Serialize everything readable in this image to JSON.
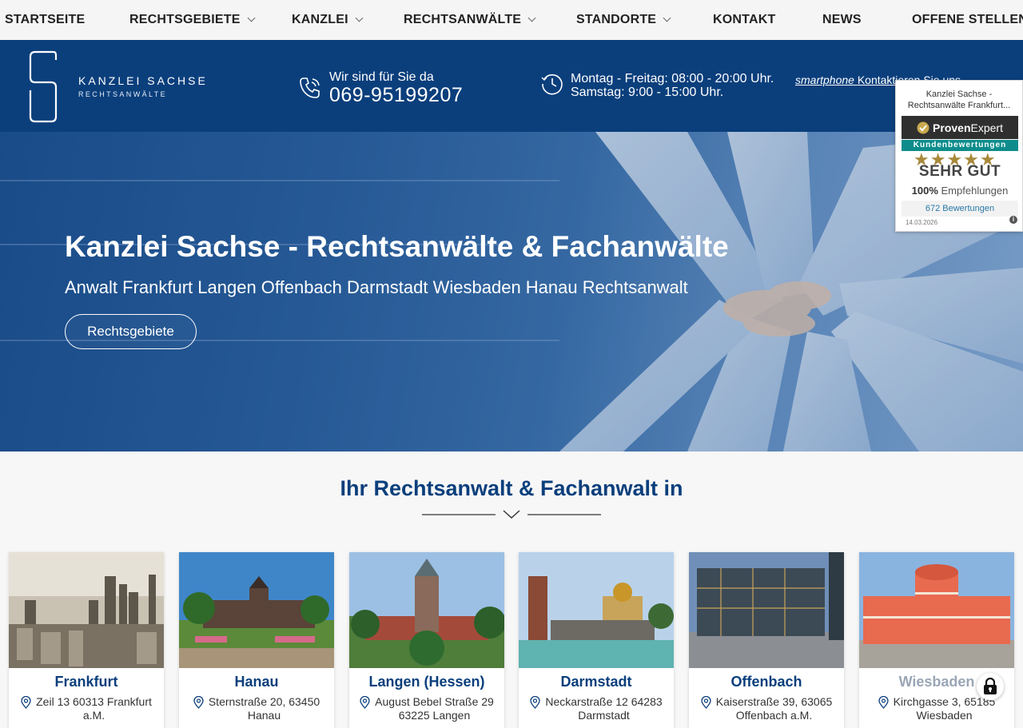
{
  "nav": {
    "items": [
      {
        "label": "STARTSEITE",
        "has_dropdown": false
      },
      {
        "label": "RECHTSGEBIETE",
        "has_dropdown": true
      },
      {
        "label": "KANZLEI",
        "has_dropdown": true
      },
      {
        "label": "RECHTSANWÄLTE",
        "has_dropdown": true
      },
      {
        "label": "STANDORTE",
        "has_dropdown": true
      },
      {
        "label": "KONTAKT",
        "has_dropdown": false
      },
      {
        "label": "NEWS",
        "has_dropdown": false
      },
      {
        "label": "OFFENE STELLEN",
        "has_dropdown": false
      }
    ]
  },
  "header": {
    "logo_name": "KANZLEI SACHSE",
    "logo_sub": "RECHTSANWÄLTE",
    "phone_label": "Wir sind für Sie da",
    "phone_number": "069-95199207",
    "hours_weekdays": "Montag - Freitag: 08:00 - 20:00 Uhr.",
    "hours_saturday": "Samstag: 9:00 - 15:00 Uhr.",
    "contact_icon_text": "smartphone",
    "contact_text": "Kontaktieren Sie uns"
  },
  "hero": {
    "title": "Kanzlei Sachse - Rechtsanwälte & Fachanwälte",
    "subtitle": "Anwalt Frankfurt Langen Offenbach Darmstadt Wiesbaden Hanau Rechtsanwalt",
    "button": "Rechtsgebiete"
  },
  "provenexpert": {
    "title_line1": "Kanzlei Sachse -",
    "title_line2": "Rechtsanwälte Frankfurt...",
    "brand_bold": "Proven",
    "brand_rest": "Expert",
    "ribbon": "Kundenbewertungen",
    "stars": "★★★★★",
    "rating": "SEHR GUT",
    "recommend_pct": "100%",
    "recommend_text": "Empfehlungen",
    "reviews": "672 Bewertungen",
    "date": "14.03.2026"
  },
  "section": {
    "title": "Ihr Rechtsanwalt & Fachanwalt in"
  },
  "locations": [
    {
      "city": "Frankfurt",
      "addr1": "Zeil 13 60313 Frankfurt",
      "addr2": "a.M."
    },
    {
      "city": "Hanau",
      "addr1": "Sternstraße 20, 63450",
      "addr2": "Hanau"
    },
    {
      "city": "Langen (Hessen)",
      "addr1": "August Bebel Straße 29",
      "addr2": "63225 Langen"
    },
    {
      "city": "Darmstadt",
      "addr1": "Neckarstraße 12 64283",
      "addr2": "Darmstadt"
    },
    {
      "city": "Offenbach",
      "addr1": "Kaiserstraße 39, 63065",
      "addr2": "Offenbach a.M."
    },
    {
      "city": "Wiesbaden",
      "addr1": "Kirchgasse 3, 65185",
      "addr2": "Wiesbaden"
    }
  ],
  "colors": {
    "brand_blue": "#0b3f7c",
    "accent_gold": "#a8893a",
    "ribbon_teal": "#0e8c8c"
  }
}
